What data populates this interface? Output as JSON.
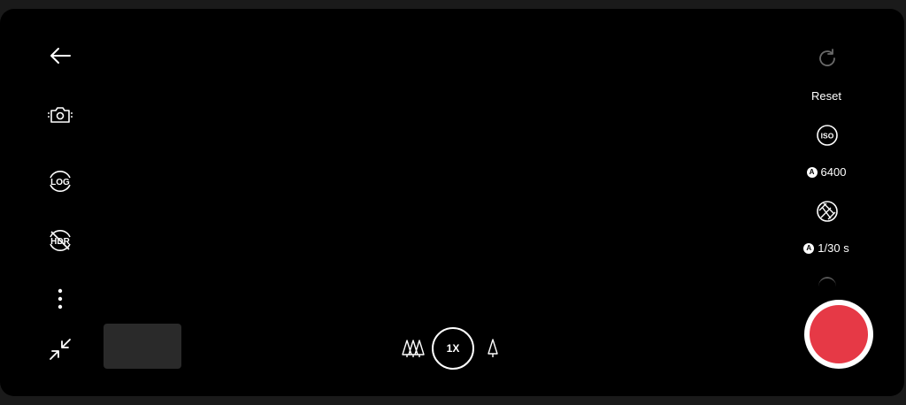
{
  "left_controls": {
    "back": "arrow-left-icon",
    "camera_switch": "camera-flip-icon",
    "log": {
      "icon": "log-icon",
      "label": "LOG"
    },
    "hdr": {
      "icon": "hdr-off-icon",
      "label": "HDR"
    },
    "more": "more-vertical-icon",
    "collapse": "minimize-icon"
  },
  "zoom": {
    "current_label": "1X",
    "wide_icon": "trees-wide-icon",
    "tele_icon": "tree-tele-icon"
  },
  "right_controls": {
    "reset_label": "Reset",
    "iso": {
      "icon": "iso-icon",
      "icon_label": "ISO",
      "auto_badge": "A",
      "value": "6400"
    },
    "shutter": {
      "icon": "shutter-aperture-icon",
      "auto_badge": "A",
      "value": "1/30 s"
    }
  },
  "record": {
    "color": "#e63946"
  },
  "colors": {
    "background": "#000000",
    "frame": "#1a1a1a",
    "thumbnail": "#2a2a2a"
  }
}
